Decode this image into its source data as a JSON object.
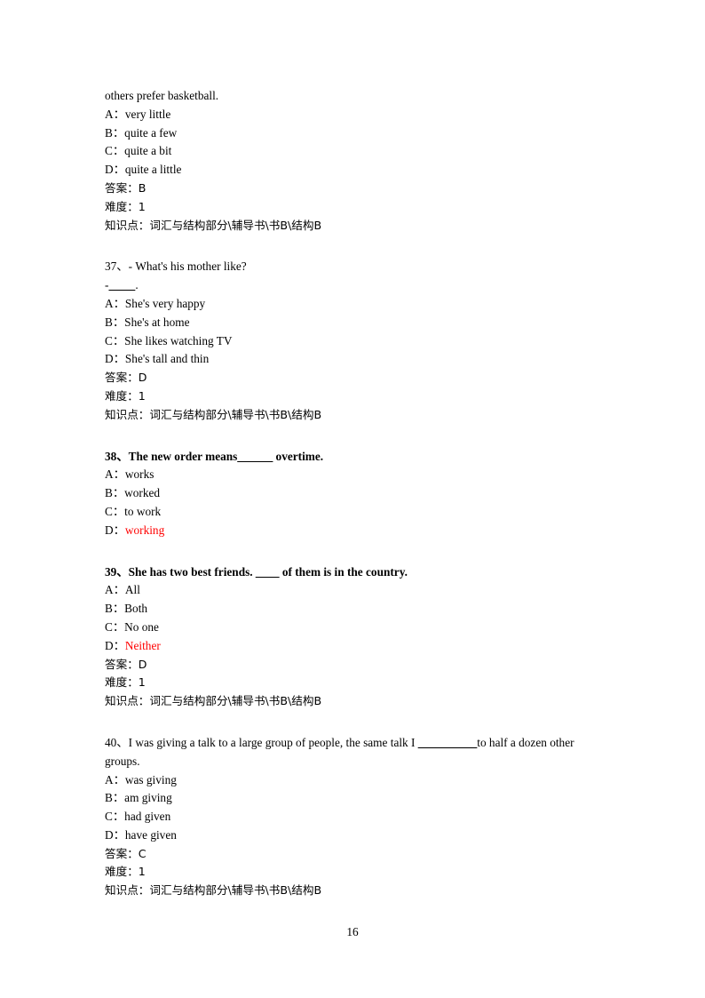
{
  "page": {
    "number": "16",
    "background": "#ffffff",
    "text_color": "#000000",
    "highlight_color": "#ff0000"
  },
  "labels": {
    "answer": "答案：",
    "difficulty": "难度：",
    "knowledge": "知识点：",
    "knowledge_value": "词汇与结构部分\\辅导书\\书B\\结构B"
  },
  "questions": [
    {
      "id": "q36-continued",
      "stem": "others prefer basketball.",
      "bold": false,
      "options": [
        {
          "mark": "A：",
          "value": "very little",
          "red": false
        },
        {
          "mark": "B：",
          "value": "quite a few",
          "red": false
        },
        {
          "mark": "C：",
          "value": "quite a bit",
          "red": false
        },
        {
          "mark": "D：",
          "value": "quite a little",
          "red": false
        }
      ],
      "answer": "B",
      "difficulty": "1",
      "knowledge": "词汇与结构部分\\辅导书\\书B\\结构B"
    },
    {
      "id": "q37",
      "number": "37、",
      "stem": "- What's his mother like?",
      "stem_second": "- ______.",
      "bold": false,
      "options": [
        {
          "mark": "A：",
          "value": "She's very happy",
          "red": false
        },
        {
          "mark": "B：",
          "value": "She's at home",
          "red": false
        },
        {
          "mark": "C：",
          "value": "She likes watching TV",
          "red": false
        },
        {
          "mark": "D：",
          "value": "She's tall and thin",
          "red": false
        }
      ],
      "answer": "D",
      "difficulty": "1",
      "knowledge": "词汇与结构部分\\辅导书\\书B\\结构B"
    },
    {
      "id": "q38",
      "number": "38、",
      "stem_pre": "The new order means",
      "stem_blank": "______",
      "stem_post": " overtime.",
      "bold": true,
      "options": [
        {
          "mark": "A：",
          "value": "works",
          "red": false
        },
        {
          "mark": "B：",
          "value": "worked",
          "red": false
        },
        {
          "mark": "C：",
          "value": "to work",
          "red": false
        },
        {
          "mark": "D：",
          "value": "working",
          "red": true
        }
      ]
    },
    {
      "id": "q39",
      "number": "39、",
      "stem_pre": "She has two best friends. ",
      "stem_blank": "____",
      "stem_post": " of them is in the country.",
      "bold": true,
      "options": [
        {
          "mark": "A：",
          "value": "All",
          "red": false
        },
        {
          "mark": "B：",
          "value": "Both",
          "red": false
        },
        {
          "mark": "C：",
          "value": "No one",
          "red": false
        },
        {
          "mark": "D：",
          "value": "Neither",
          "red": true
        }
      ],
      "answer": "D",
      "difficulty": "1",
      "knowledge": "词汇与结构部分\\辅导书\\书B\\结构B"
    },
    {
      "id": "q40",
      "number": "40、",
      "stem_pre": "I was giving a talk to a large group of people, the same talk I ",
      "stem_blank": "__________",
      "stem_post": "to half a dozen other groups.",
      "bold": false,
      "options": [
        {
          "mark": "A：",
          "value": "was giving",
          "red": false
        },
        {
          "mark": "B：",
          "value": "am giving",
          "red": false
        },
        {
          "mark": "C：",
          "value": "had given",
          "red": false
        },
        {
          "mark": "D：",
          "value": "have given",
          "red": false
        }
      ],
      "answer": "C",
      "difficulty": "1",
      "knowledge": "词汇与结构部分\\辅导书\\书B\\结构B"
    }
  ]
}
